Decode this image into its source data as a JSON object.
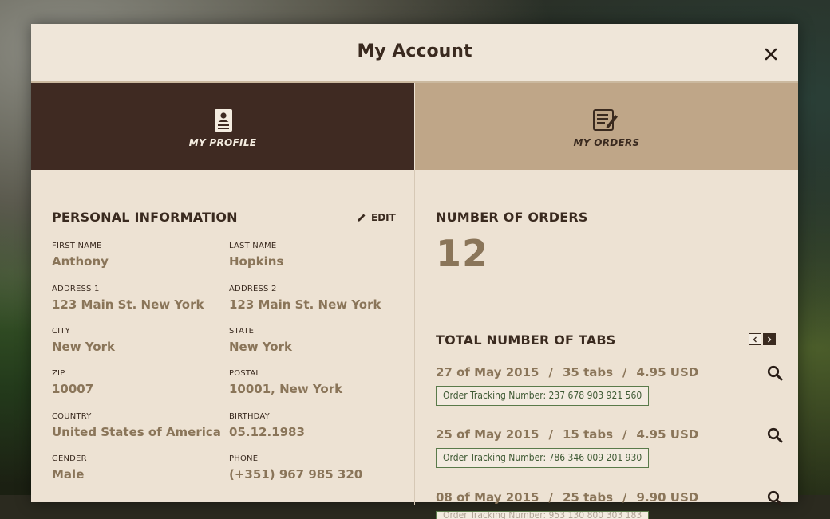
{
  "modal": {
    "title": "My Account"
  },
  "tabs": [
    {
      "label": "MY PROFILE",
      "icon": "profile-card-icon",
      "active": true
    },
    {
      "label": "MY ORDERS",
      "icon": "orders-edit-icon",
      "active": false
    }
  ],
  "profile": {
    "section_title": "PERSONAL INFORMATION",
    "edit_label": "EDIT",
    "fields": [
      {
        "label": "FIRST NAME",
        "value": "Anthony"
      },
      {
        "label": "LAST NAME",
        "value": "Hopkins"
      },
      {
        "label": "ADDRESS 1",
        "value": "123 Main St. New York"
      },
      {
        "label": "ADDRESS 2",
        "value": "123 Main St. New York"
      },
      {
        "label": "CITY",
        "value": "New York"
      },
      {
        "label": "STATE",
        "value": "New York"
      },
      {
        "label": "ZIP",
        "value": "10007"
      },
      {
        "label": "POSTAL",
        "value": "10001, New York"
      },
      {
        "label": "COUNTRY",
        "value": "United States of America"
      },
      {
        "label": "BIRTHDAY",
        "value": "05.12.1983"
      },
      {
        "label": "GENDER",
        "value": "Male"
      },
      {
        "label": "PHONE",
        "value": "(+351) 967 985 320"
      }
    ]
  },
  "orders": {
    "count_title": "NUMBER OF ORDERS",
    "count_value": "12",
    "tabs_title": "TOTAL NUMBER OF TABS",
    "list": [
      {
        "date": "27 of May 2015",
        "tabs": "35 tabs",
        "price": "4.95 USD",
        "tracking": "Order Tracking Number: 237 678 903 921 560"
      },
      {
        "date": "25 of May 2015",
        "tabs": "15 tabs",
        "price": "4.95 USD",
        "tracking": "Order Tracking Number: 786 346 009 201 930"
      },
      {
        "date": "08 of May 2015",
        "tabs": "25 tabs",
        "price": "9.90 USD",
        "tracking": "Order Tracking Number: 953 130 800 303 183"
      }
    ]
  },
  "colors": {
    "profile_tab": "#3f2a22",
    "orders_tab": "#bfa688",
    "panel_bg": "#ede2d3",
    "value_text": "#8a7559",
    "tracking_border": "#5a7a4a"
  }
}
